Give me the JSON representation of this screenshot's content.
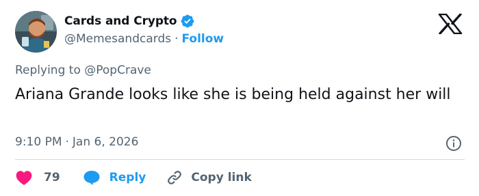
{
  "author": {
    "display_name": "Cards and Crypto",
    "handle": "@Memesandcards",
    "separator": "·",
    "follow_label": "Follow",
    "verified_icon": "verified-badge-icon",
    "avatar_icon": "avatar"
  },
  "brand": {
    "logo_icon": "x-logo-icon"
  },
  "reply_context": {
    "prefix": "Replying to",
    "mention": "@PopCrave"
  },
  "tweet": {
    "text": "Ariana Grande looks like she is being held against her will",
    "time": "9:10 PM",
    "separator": "·",
    "date": "Jan 6, 2026",
    "info_icon": "info-icon"
  },
  "actions": {
    "like_count": "79",
    "like_icon": "heart-icon",
    "reply_label": "Reply",
    "reply_icon": "speech-bubble-icon",
    "copy_label": "Copy link",
    "copy_icon": "link-icon"
  },
  "colors": {
    "accent": "#1d9bf0",
    "like": "#f91880",
    "text_primary": "#0f1419",
    "text_secondary": "#536471",
    "divider": "#cfd9de"
  }
}
